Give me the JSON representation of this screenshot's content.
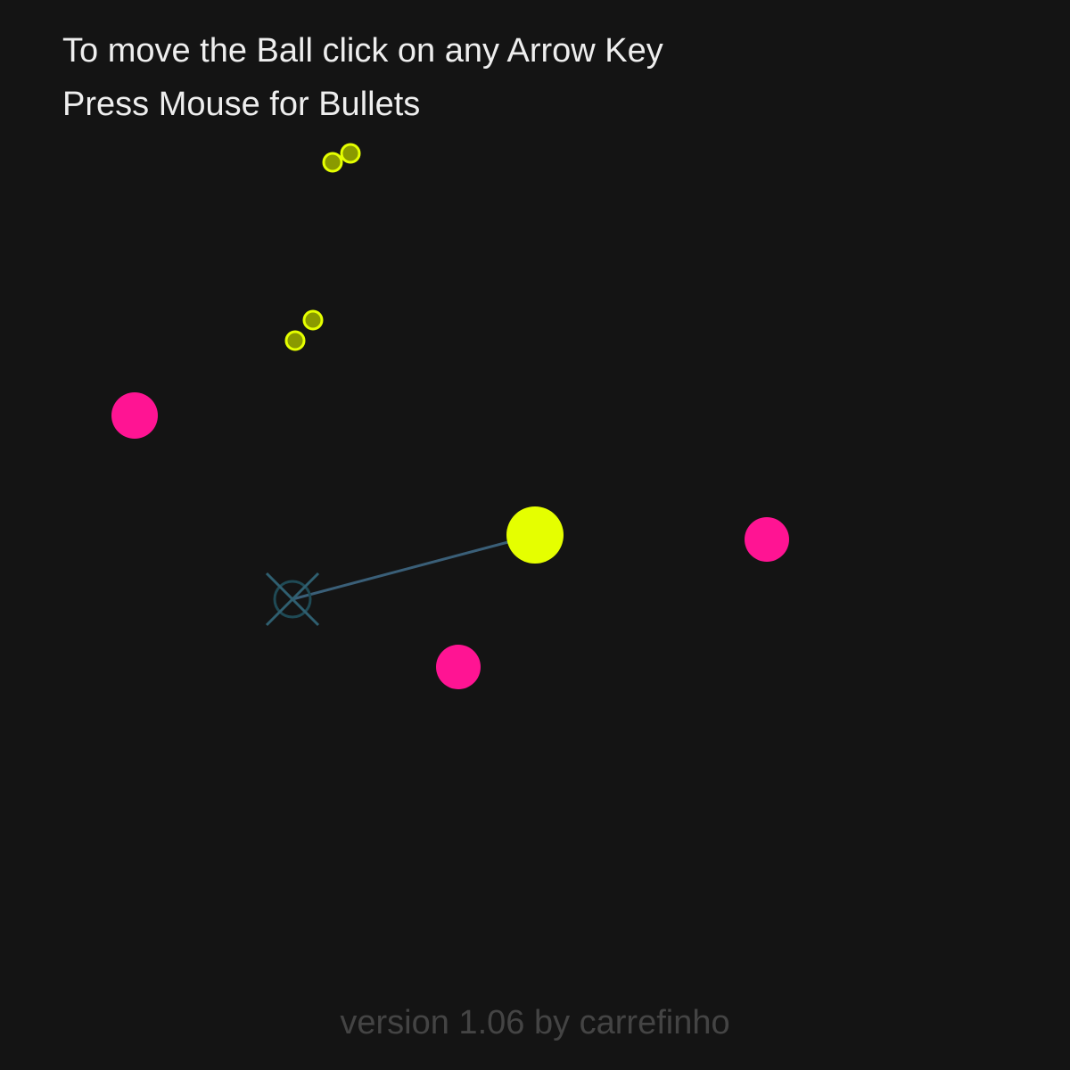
{
  "instructions": {
    "move": "To move the Ball click on any Arrow Key",
    "shoot": "Press Mouse for Bullets"
  },
  "footer": {
    "version": "version 1.06 by carrefinho"
  },
  "colors": {
    "background": "#141414",
    "player": "#e5ff00",
    "enemy": "#ff1493",
    "bullet_fill": "#8a9a00",
    "bullet_stroke": "#e5ff00",
    "aim_line": "#3a5f78",
    "crosshair": "#2f5f70",
    "instruction_text": "#eeeeee",
    "version_text": "#444444"
  },
  "icons": {
    "player": "player-ball",
    "enemy": "enemy-ball",
    "bullet": "bullet",
    "crosshair": "crosshair-icon"
  }
}
